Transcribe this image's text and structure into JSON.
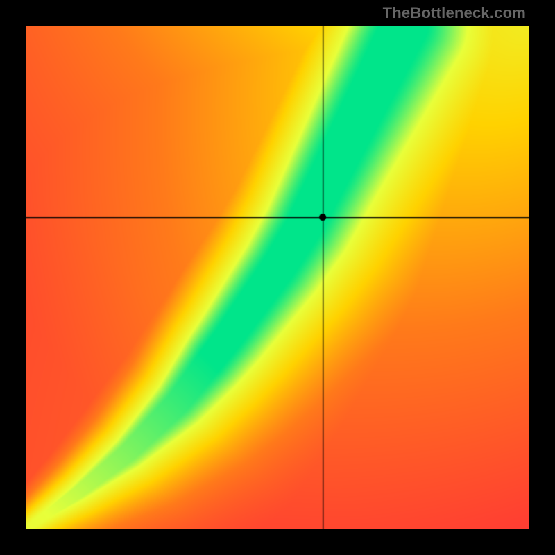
{
  "watermark": "TheBottleneck.com",
  "chart_data": {
    "type": "heatmap",
    "title": "",
    "xlabel": "",
    "ylabel": "",
    "xlim": [
      0,
      100
    ],
    "ylim": [
      0,
      100
    ],
    "crosshair": {
      "x": 59,
      "y": 62
    },
    "ridge_points": [
      {
        "x": 0,
        "y": 0
      },
      {
        "x": 10,
        "y": 7
      },
      {
        "x": 20,
        "y": 15
      },
      {
        "x": 30,
        "y": 25
      },
      {
        "x": 40,
        "y": 38
      },
      {
        "x": 50,
        "y": 52
      },
      {
        "x": 55,
        "y": 60
      },
      {
        "x": 60,
        "y": 70
      },
      {
        "x": 65,
        "y": 80
      },
      {
        "x": 70,
        "y": 90
      },
      {
        "x": 75,
        "y": 100
      }
    ],
    "ridge_width_x": [
      {
        "x": 0,
        "half": 0.5
      },
      {
        "x": 30,
        "half": 2.2
      },
      {
        "x": 50,
        "half": 3.2
      },
      {
        "x": 70,
        "half": 4.2
      },
      {
        "x": 100,
        "half": 6.0
      }
    ],
    "corner_colors": {
      "top_left": "#ff2a3a",
      "top_right": "#ffd200",
      "bottom_left": "#ff2a3a",
      "bottom_right": "#ff2a3a",
      "ridge": "#00e58a",
      "ridge_edge": "#e8ff3a"
    },
    "gradient_stops": [
      {
        "t": 0.0,
        "color": "#ff2a3a"
      },
      {
        "t": 0.35,
        "color": "#ff7a1a"
      },
      {
        "t": 0.6,
        "color": "#ffd200"
      },
      {
        "t": 0.82,
        "color": "#e8ff3a"
      },
      {
        "t": 1.0,
        "color": "#00e58a"
      }
    ]
  }
}
